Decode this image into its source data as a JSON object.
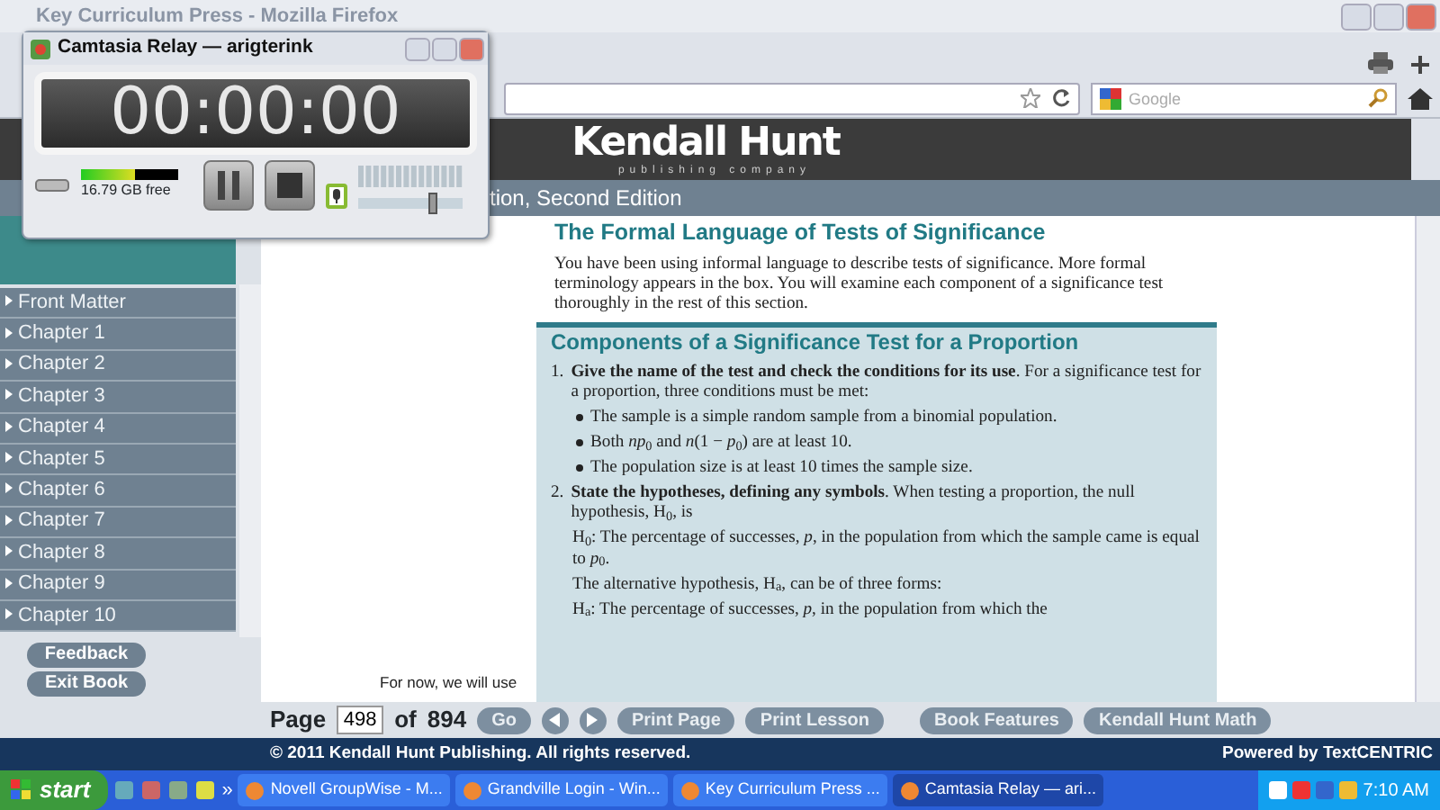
{
  "browser": {
    "title": "Key Curriculum Press - Mozilla Firefox",
    "search": {
      "placeholder": "Google"
    }
  },
  "recorder": {
    "title": "Camtasia Relay — arigterink",
    "timer": "00:00:00",
    "disk": {
      "level": 0.55,
      "free": "16.79 GB free"
    },
    "volume": {
      "level": 0.72
    },
    "mic_on": true
  },
  "site": {
    "logo": "Kendall Hunt",
    "tagline": "publishing company",
    "band_text": "tion, Second Edition",
    "sidebar": {
      "items": [
        {
          "label": "Front Matter"
        },
        {
          "label": "Chapter 1"
        },
        {
          "label": "Chapter 2"
        },
        {
          "label": "Chapter 3"
        },
        {
          "label": "Chapter 4"
        },
        {
          "label": "Chapter 5"
        },
        {
          "label": "Chapter 6"
        },
        {
          "label": "Chapter 7"
        },
        {
          "label": "Chapter 8"
        },
        {
          "label": "Chapter 9"
        },
        {
          "label": "Chapter 10"
        }
      ],
      "buttons": [
        "Feedback",
        "Exit Book"
      ]
    },
    "side_note": "For now, we will use",
    "heading": "The Formal Language of Tests of Significance",
    "intro": "You have been using informal language to describe tests of significance. More formal terminology appears in the box. You will examine each component of a significance test thoroughly in the rest of this section.",
    "box": {
      "title": "Components of a Significance Test for a Proportion",
      "items": [
        {
          "kind": "numbered",
          "number": "1.",
          "text": "**Give the name of the test and check the conditions for its use**. For a significance test for a proportion, three conditions must be met:"
        },
        {
          "kind": "bullet",
          "text": "The sample is a simple random sample from a binomial population."
        },
        {
          "kind": "bullet",
          "text": "Both *np*$_{0}$ and *n*(1 − *p*$_{0}$) are at least 10."
        },
        {
          "kind": "bullet",
          "text": "The population size is at least 10 times the sample size."
        },
        {
          "kind": "numbered",
          "number": "2.",
          "text": "**State the hypotheses, defining any symbols**. When testing a proportion, the null hypothesis, H$_{0}$, is"
        },
        {
          "kind": "hypothesis",
          "text": "H$_{0}$: The percentage of successes, *p*, in the population from which the sample came is equal to *p*$_{0}$."
        },
        {
          "kind": "plain",
          "text": "The alternative hypothesis, H$_{a}$, can be of three forms:"
        },
        {
          "kind": "hypothesis",
          "text": "H$_{a}$: The percentage of successes, *p*, in the population from which the"
        }
      ]
    },
    "pager": {
      "label": "Page",
      "page": "498",
      "of": "of",
      "total": "894",
      "go": "Go",
      "buttons": [
        "Print Page",
        "Print Lesson",
        "Book Features",
        "Kendall Hunt Math"
      ]
    },
    "footer": {
      "copyright": "© 2011 Kendall Hunt Publishing. All rights reserved.",
      "powered": "Powered by TextCENTRIC"
    }
  },
  "taskbar": {
    "start": "start",
    "more": "»",
    "tasks": [
      {
        "label": "Novell GroupWise - M...",
        "selected": false
      },
      {
        "label": "Grandville Login - Win...",
        "selected": false
      },
      {
        "label": "Key Curriculum Press ...",
        "selected": false
      },
      {
        "label": "Camtasia Relay — ari...",
        "selected": true
      }
    ],
    "clock": "7:10 AM"
  }
}
